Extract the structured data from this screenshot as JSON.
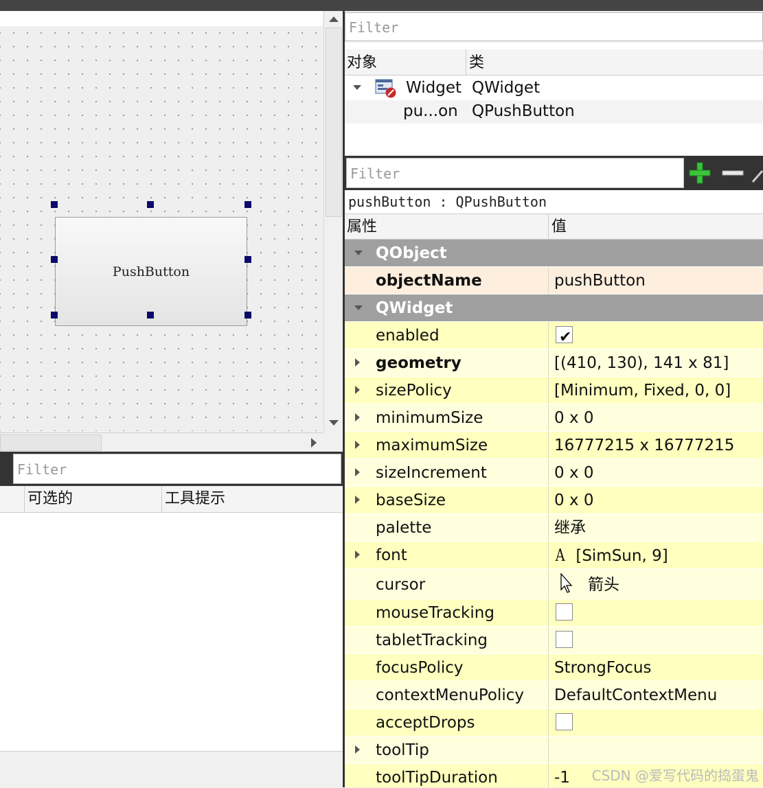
{
  "canvas": {
    "button_text": "PushButton"
  },
  "action_editor": {
    "filter_placeholder": "Filter",
    "columns": [
      "可选的",
      "工具提示"
    ]
  },
  "object_inspector": {
    "filter_placeholder": "Filter",
    "columns": [
      "对象",
      "类"
    ],
    "rows": [
      {
        "name": "Widget",
        "class": "QWidget"
      },
      {
        "name": "pu...on",
        "class": "QPushButton"
      }
    ]
  },
  "property_editor": {
    "filter_placeholder": "Filter",
    "class_label": "pushButton : QPushButton",
    "columns": [
      "属性",
      "值"
    ],
    "groups": {
      "qobject": "QObject",
      "qwidget": "QWidget"
    },
    "properties": {
      "objectName": {
        "name": "objectName",
        "value": "pushButton"
      },
      "enabled": {
        "name": "enabled",
        "checked": true
      },
      "geometry": {
        "name": "geometry",
        "value": "[(410, 130), 141 x 81]"
      },
      "sizePolicy": {
        "name": "sizePolicy",
        "value": "[Minimum, Fixed, 0, 0]"
      },
      "minimumSize": {
        "name": "minimumSize",
        "value": "0 x 0"
      },
      "maximumSize": {
        "name": "maximumSize",
        "value": "16777215 x 16777215"
      },
      "sizeIncrement": {
        "name": "sizeIncrement",
        "value": "0 x 0"
      },
      "baseSize": {
        "name": "baseSize",
        "value": "0 x 0"
      },
      "palette": {
        "name": "palette",
        "value": "继承"
      },
      "font": {
        "name": "font",
        "icon_glyph": "A",
        "value": "[SimSun, 9]"
      },
      "cursor": {
        "name": "cursor",
        "value": "箭头"
      },
      "mouseTracking": {
        "name": "mouseTracking",
        "checked": false
      },
      "tabletTracking": {
        "name": "tabletTracking",
        "checked": false
      },
      "focusPolicy": {
        "name": "focusPolicy",
        "value": "StrongFocus"
      },
      "contextMenuPolicy": {
        "name": "contextMenuPolicy",
        "value": "DefaultContextMenu"
      },
      "acceptDrops": {
        "name": "acceptDrops",
        "checked": false
      },
      "toolTip": {
        "name": "toolTip",
        "value": ""
      },
      "toolTipDuration": {
        "name": "toolTipDuration",
        "value": "-1"
      }
    }
  },
  "watermark": "CSDN @爱写代码的捣蛋鬼",
  "colors": {
    "group_header": "#a0a0a0",
    "row_yellow_light": "#ffffde",
    "row_yellow": "#ffffbf",
    "row_selected": "#fdeede",
    "handle": "#0a0a6a",
    "add_button": "#3cc43c"
  }
}
